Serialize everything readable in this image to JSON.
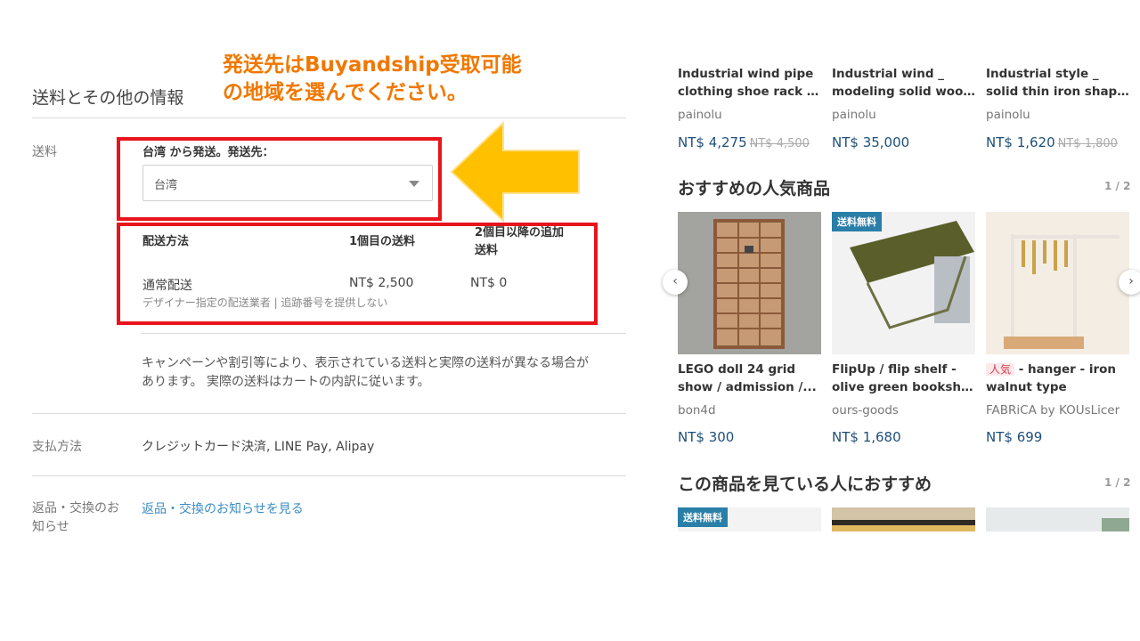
{
  "annotation": {
    "line1": "発送先はBuyandship受取可能",
    "line2": "の地域を選んでください。"
  },
  "shipping": {
    "section_title": "送料とその他の情報",
    "label": "送料",
    "ship_from_text": "台湾 から発送。発送先：",
    "destination_value": "台湾",
    "table_headers": [
      "配送方法",
      "1個目の送料",
      "2個目以降の追加",
      "送料"
    ],
    "method": "通常配送",
    "first_fee": "NT$ 2,500",
    "additional_fee": "NT$ 0",
    "method_note": "デザイナー指定の配送業者 | 追跡番号を提供しない",
    "disclaimer_line1": "キャンペーンや割引等により、表示されている送料と実際の送料が異なる場合が",
    "disclaimer_line2": "あります。 実際の送料はカートの内訳に従います。"
  },
  "payment": {
    "label": "支払方法",
    "value": "クレジットカード決済, LINE Pay, Alipay"
  },
  "returns": {
    "label_line1": "返品・交換のお",
    "label_line2": "知らせ",
    "link": "返品・交換のお知らせを見る"
  },
  "top_products": [
    {
      "title1": "Industrial wind pipe",
      "title2": "clothing shoe rack /...",
      "shop": "painolu",
      "price": "NT$ 4,275",
      "old_price": "NT$ 4,500"
    },
    {
      "title1": "Industrial wind _",
      "title2": "modeling solid woo...",
      "shop": "painolu",
      "price": "NT$ 35,000",
      "old_price": ""
    },
    {
      "title1": "Industrial style _",
      "title2": "solid thin iron shap...",
      "shop": "painolu",
      "price": "NT$ 1,620",
      "old_price": "NT$ 1,800"
    }
  ],
  "popular_section": {
    "heading": "おすすめの人気商品",
    "pager": "1 / 2",
    "products": [
      {
        "title1": "LEGO doll 24 grid",
        "title2": "show / admission /...",
        "shop": "bon4d",
        "price": "NT$ 300",
        "badge": "",
        "tag": ""
      },
      {
        "title1": "FlipUp / flip shelf -",
        "title2": "olive green bookshelf",
        "shop": "ours-goods",
        "price": "NT$ 1,680",
        "badge": "送料無料",
        "tag": ""
      },
      {
        "title1": " - hanger - iron",
        "title2": "walnut type",
        "shop": "FABRiCA by KOUsLicer",
        "price": "NT$ 699",
        "badge": "",
        "tag": "人気"
      }
    ]
  },
  "recommend_section": {
    "heading": "この商品を見ている人におすすめ",
    "pager": "1 / 2",
    "badge": "送料無料"
  },
  "icons": {
    "prev": "‹",
    "next": "›"
  }
}
